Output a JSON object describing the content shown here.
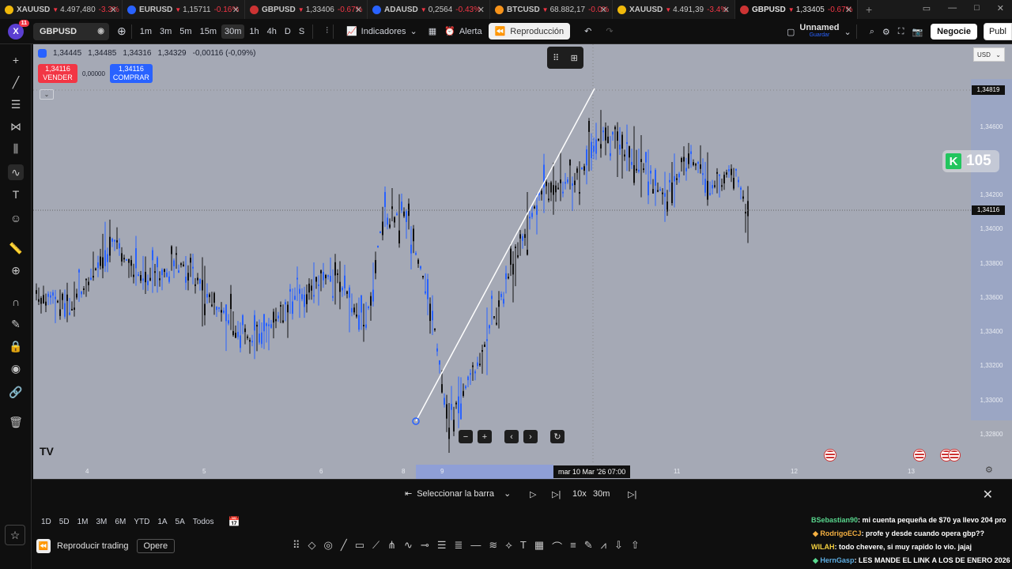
{
  "tabs": [
    {
      "name": "XAUUSD",
      "price": "4.497,480",
      "change": "-3.3%",
      "icon_color": "#f0b90b"
    },
    {
      "name": "EURUSD",
      "price": "1,15711",
      "change": "-0.16%",
      "icon_color": "#2962ff"
    },
    {
      "name": "GBPUSD",
      "price": "1,33406",
      "change": "-0.67%",
      "icon_color": "#c33"
    },
    {
      "name": "ADAUSD",
      "price": "0,2564",
      "change": "-0.43%",
      "icon_color": "#2962ff"
    },
    {
      "name": "BTCUSD",
      "price": "68.882,17",
      "change": "-0.0%",
      "icon_color": "#f7931a"
    },
    {
      "name": "XAUUSD",
      "price": "4.491,39",
      "change": "-3.4%",
      "icon_color": "#f0b90b"
    },
    {
      "name": "GBPUSD",
      "price": "1,33405",
      "change": "-0.67%",
      "icon_color": "#c33"
    }
  ],
  "toolbar": {
    "avatar_letter": "X",
    "notifications": "11",
    "symbol": "GBPUSD",
    "timeframes": [
      "1m",
      "3m",
      "5m",
      "15m",
      "30m",
      "1h",
      "4h",
      "D",
      "S"
    ],
    "active_timeframe": "30m",
    "indicators_label": "Indicadores",
    "alert_label": "Alerta",
    "replay_label": "Reproducción",
    "layout_name": "Unnamed",
    "layout_status": "Guardar",
    "trade_label": "Negocie",
    "publish_label": "Publ"
  },
  "chart": {
    "ohlc": {
      "o": "1,34445",
      "h": "1,34485",
      "l": "1,34316",
      "c": "1,34329",
      "chg": "-0,00116 (-0,09%)"
    },
    "sell": {
      "price": "1,34116",
      "label": "VENDER"
    },
    "buy": {
      "price": "1,34116",
      "label": "COMPRAR"
    },
    "spread": "0,00000",
    "currency": "USD",
    "price_ticks": [
      "1,34600",
      "1,34200",
      "1,34000",
      "1,33800",
      "1,33600",
      "1,33400",
      "1,33200",
      "1,33000",
      "1,32800"
    ],
    "high_label": "1,34819",
    "current_label": "1,34116",
    "time_ticks": [
      "4",
      "5",
      "6",
      "8",
      "9",
      "11",
      "12",
      "13"
    ],
    "crosshair_time": "mar 10 Mar '26   07:00",
    "k_badge": "105"
  },
  "replay": {
    "select_bar": "Seleccionar la barra",
    "speed": "10x",
    "interval": "30m"
  },
  "ranges": [
    "1D",
    "5D",
    "1M",
    "3M",
    "6M",
    "YTD",
    "1A",
    "5A",
    "Todos"
  ],
  "bottom": {
    "replay_trading": "Reproducir trading",
    "trade": "Opere"
  },
  "chat": [
    {
      "user": "BSebastian90",
      "text": ": mi cuenta pequeña de $70 ya llevo 204 pro"
    },
    {
      "user": "RodrigoECJ",
      "text": ": profe y desde cuando opera gbp??"
    },
    {
      "user": "WILAH",
      "text": ": todo chevere, si muy rapido lo vio. jajaj"
    },
    {
      "user": "HernGasp",
      "text": ": LES MANDE EL LINK A LOS DE ENERO 2026"
    }
  ]
}
